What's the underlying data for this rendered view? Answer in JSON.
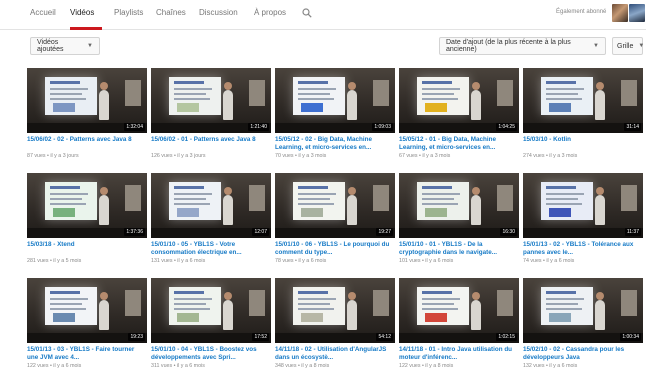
{
  "tabs": [
    {
      "label": "Accueil"
    },
    {
      "label": "Vidéos"
    },
    {
      "label": "Playlists"
    },
    {
      "label": "Chaînes"
    },
    {
      "label": "Discussion"
    },
    {
      "label": "À propos"
    }
  ],
  "active_tab": "Vidéos",
  "header": {
    "subscribed_label": "Également abonné",
    "search_icon": "search-icon"
  },
  "toolbar": {
    "uploaded_label": "Vidéos ajoutées",
    "sort_label": "Date d'ajout (de la plus récente à la plus ancienne)",
    "grid_label": "Grille"
  },
  "colors": {
    "accent_red": "#cc181e",
    "link_blue": "#167ac6"
  },
  "videos": [
    {
      "title": "15/06/02 - 02 - Patterns avec Java 8",
      "meta": "87 vues • il y a 3 jours",
      "duration": "1:32:04",
      "screen": "#e9eef4",
      "block": "#7d96c2"
    },
    {
      "title": "15/06/02 - 01 - Patterns avec Java 8",
      "meta": "126 vues • il y a 3 jours",
      "duration": "1:21:40",
      "screen": "#eef1ef",
      "block": "#b4c6a0"
    },
    {
      "title": "15/05/12 - 02 - Big Data, Machine Learning, et micro-services en...",
      "meta": "70 vues • il y a 3 mois",
      "duration": "1:09:03",
      "screen": "#f1f3f6",
      "block": "#3e6fd1"
    },
    {
      "title": "15/05/12 - 01 - Big Data, Machine Learning, et micro-services en...",
      "meta": "67 vues • il y a 3 mois",
      "duration": "1:04:25",
      "screen": "#f3f3ef",
      "block": "#e2b11f"
    },
    {
      "title": "15/03/10 - Kotlin",
      "meta": "274 vues • il y a 3 mois",
      "duration": "31:14",
      "screen": "#eaf0f5",
      "block": "#5b7fb6"
    },
    {
      "title": "15/03/18 - Xtend",
      "meta": "281 vues • il y a 5 mois",
      "duration": "1:37:36",
      "screen": "#eaf4ec",
      "block": "#78b17e"
    },
    {
      "title": "15/01/10 - 05 - YBL1S - Votre consommation électrique en...",
      "meta": "131 vues • il y a 6 mois",
      "duration": "12:07",
      "screen": "#eef2f6",
      "block": "#95a7c9"
    },
    {
      "title": "15/01/10 - 06 - YBL1S - Le pourquoi du comment du type...",
      "meta": "78 vues • il y a 6 mois",
      "duration": "19:27",
      "screen": "#f2f4ef",
      "block": "#a8b2a0"
    },
    {
      "title": "15/01/10 - 01 - YBL1S - De la cryptographie dans le navigate...",
      "meta": "101 vues • il y a 6 mois",
      "duration": "16:30",
      "screen": "#edf1ec",
      "block": "#9cb48f"
    },
    {
      "title": "15/01/13 - 02 - YBL1S - Tolérance aux pannes avec le...",
      "meta": "74 vues • il y a 6 mois",
      "duration": "11:37",
      "screen": "#e8ecf6",
      "block": "#3f55b8"
    },
    {
      "title": "15/01/13 - 03 - YBL1S - Faire tourner une JVM avec 4...",
      "meta": "122 vues • il y a 6 mois",
      "duration": "19:23",
      "screen": "#f2f4f7",
      "block": "#6a8ab0"
    },
    {
      "title": "15/01/10 - 04 - YBL1S - Boostez vos développements avec Spri...",
      "meta": "311 vues • il y a 6 mois",
      "duration": "17:52",
      "screen": "#eff3ee",
      "block": "#a3b792"
    },
    {
      "title": "14/11/18 - 02 - Utilisation d'AngularJS dans un écosystè...",
      "meta": "348 vues • il y a 8 mois",
      "duration": "54:12",
      "screen": "#f1f2ee",
      "block": "#b7b7a6"
    },
    {
      "title": "14/11/18 - 01 - Intro Java utilisation du moteur d'inférenc...",
      "meta": "122 vues • il y a 8 mois",
      "duration": "1:02:15",
      "screen": "#f3f4f1",
      "block": "#d2463a"
    },
    {
      "title": "15/02/10 - 02 - Cassandra pour les développeurs Java",
      "meta": "132 vues • il y a 6 mois",
      "duration": "1:00:34",
      "screen": "#eef1f4",
      "block": "#8aa6b9"
    }
  ]
}
